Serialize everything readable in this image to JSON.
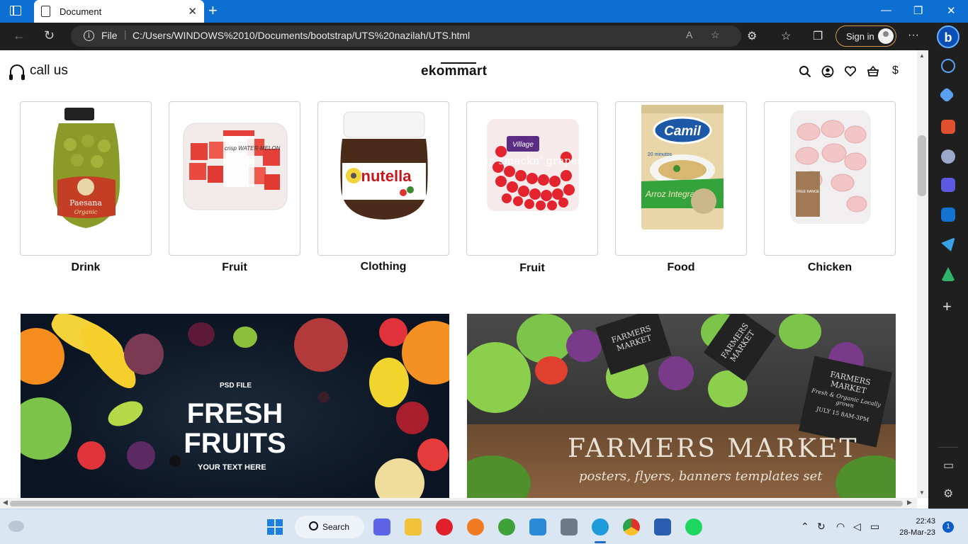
{
  "browser": {
    "tab_title": "Document",
    "tab_close": "✕",
    "new_tab": "+",
    "min": "—",
    "max": "❐",
    "close": "✕",
    "address_file": "File",
    "address_url": "C:/Users/WINDOWS%2010/Documents/bootstrap/UTS%20nazilah/UTS.html",
    "sign_in": "Sign in",
    "more": "···",
    "bing": "b"
  },
  "header": {
    "call_us": "call us",
    "brand": "ekommart",
    "currency": "$"
  },
  "categories": [
    {
      "label": "Drink"
    },
    {
      "label": "Fruit"
    },
    {
      "label": "Clothing"
    },
    {
      "label": "Fruit"
    },
    {
      "label": "Food"
    },
    {
      "label": "Chicken"
    }
  ],
  "products": {
    "olive_brand": "Paesana",
    "olive_sub": "Organic",
    "watermelon_text": "crisp WATER-MELON",
    "nutella": "nutella",
    "grapes_brand": "Village",
    "grapes_text": "lip smackn' grapes",
    "rice_brand": "Camil",
    "rice_text": "Arroz Integral",
    "rice_minutes": "20 minutos",
    "chicken_text": "FREE RANGE"
  },
  "banners": {
    "fruits_psd": "PSD FILE",
    "fruits_title": "FRESH FRUITS",
    "fruits_sub": "YOUR TEXT HERE",
    "farmers_title": "FARMERS MARKET",
    "farmers_sub": "posters, flyers, banners templates set",
    "flag_1": "FARMERS MARKET",
    "flag_2": "FARMERS MARKET",
    "flag_3": "FARMERS MARKET",
    "flag_3_sub": "Fresh & Organic Locally grown",
    "flag_3_date": "JULY 15 8AM-3PM"
  },
  "taskbar": {
    "search": "Search",
    "time": "22:43",
    "date": "28-Mar-23",
    "notifications": "1"
  }
}
